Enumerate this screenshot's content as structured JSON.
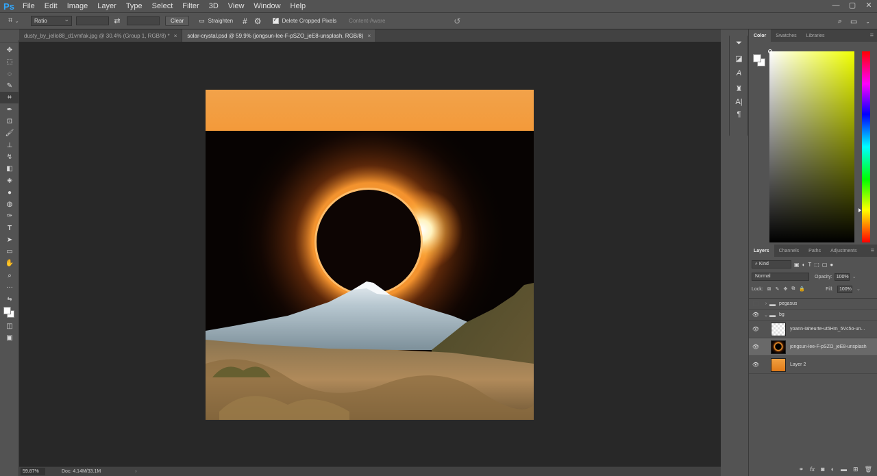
{
  "app": {
    "logo": "Ps"
  },
  "menu": [
    "File",
    "Edit",
    "Image",
    "Layer",
    "Type",
    "Select",
    "Filter",
    "3D",
    "View",
    "Window",
    "Help"
  ],
  "window_controls": [
    "—",
    "▢",
    "✕"
  ],
  "options": {
    "ratio": "Ratio",
    "clear": "Clear",
    "straighten": "Straighten",
    "delete_cropped": "Delete Cropped Pixels",
    "content_aware": "Content-Aware"
  },
  "tabs": [
    {
      "label": "dusty_by_jello88_d1vmfak.jpg @ 30.4% (Group 1, RGB/8) *",
      "close": "×"
    },
    {
      "label": "solar-crystal.psd @ 59.9% (jongsun-lee-F-pSZO_jeE8-unsplash, RGB/8)",
      "close": "×"
    }
  ],
  "status": {
    "zoom": "59.87%",
    "doc": "Doc: 4.14M/33.1M",
    "arrow": "›"
  },
  "color_panel": {
    "tabs": [
      "Color",
      "Swatches",
      "Libraries"
    ],
    "menu": "≡"
  },
  "layers_panel": {
    "tabs": [
      "Layers",
      "Channels",
      "Paths",
      "Adjustments"
    ],
    "menu": "≡",
    "kind": "Kind",
    "blend": "Normal",
    "opacity_label": "Opacity:",
    "opacity": "100%",
    "lock_label": "Lock:",
    "fill_label": "Fill:",
    "fill": "100%",
    "layers": [
      {
        "name": "pegasus",
        "type": "group"
      },
      {
        "name": "bg",
        "type": "group"
      },
      {
        "name": "yoann-laheurte-ut5Hm_5Vc5o-un...",
        "type": "layer"
      },
      {
        "name": "jongsun-lee-F-pSZO_jeE8-unsplash",
        "type": "layer"
      },
      {
        "name": "Layer 2",
        "type": "layer"
      }
    ]
  },
  "colors": {
    "accent": "#31a8ff",
    "canvas_bg": "#282828",
    "ui_bg": "#535353"
  },
  "icons": {
    "toolbar": [
      "move-icon",
      "marquee-icon",
      "lasso-icon",
      "quick-select-icon",
      "crop-icon",
      "eyedropper-icon",
      "spot-heal-icon",
      "brush-icon",
      "stamp-icon",
      "history-brush-icon",
      "eraser-icon",
      "bucket-icon",
      "blur-icon",
      "dodge-icon",
      "pen-icon",
      "type-icon",
      "path-select-icon",
      "rectangle-icon",
      "hand-icon",
      "zoom-icon",
      "more-icon"
    ]
  }
}
